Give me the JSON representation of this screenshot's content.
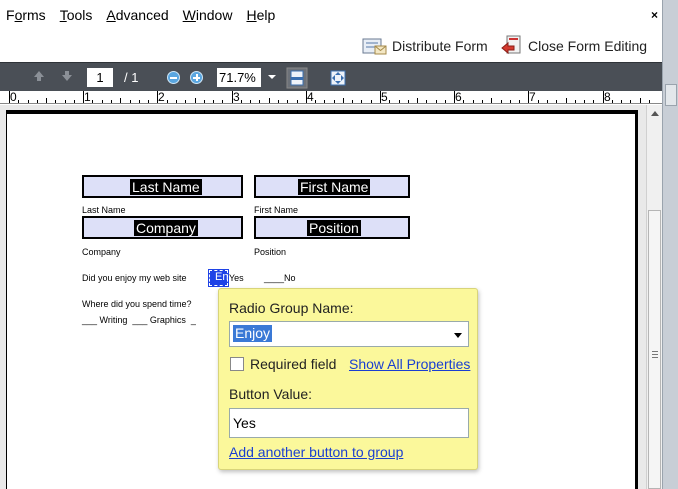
{
  "menu": {
    "items": [
      {
        "pre": "F",
        "u": "o",
        "post": "rms"
      },
      {
        "pre": "",
        "u": "T",
        "post": "ools"
      },
      {
        "pre": "",
        "u": "A",
        "post": "dvanced"
      },
      {
        "pre": "",
        "u": "W",
        "post": "indow"
      },
      {
        "pre": "",
        "u": "H",
        "post": "elp"
      }
    ],
    "close": "×"
  },
  "formbar": {
    "distribute": "Distribute Form",
    "close_editing": "Close Form Editing"
  },
  "navbar": {
    "page_current": "1",
    "page_total": "/ 1",
    "zoom": "71.7%"
  },
  "ruler": {
    "labels": [
      "0",
      "1",
      "2",
      "3",
      "4",
      "5",
      "6",
      "7",
      "8"
    ]
  },
  "form": {
    "last_name_field": "Last Name",
    "first_name_field": "First Name",
    "last_name_caption": "Last Name",
    "first_name_caption": "First Name",
    "company_field": "Company",
    "position_field": "Position",
    "company_caption": "Company",
    "position_caption": "Position",
    "question1": "Did you enjoy my web site",
    "radio_label": "En",
    "yes_text": "Yes",
    "no_text": "____No",
    "question2": "Where did you spend time?",
    "options": "___ Writing  ___ Graphics  _"
  },
  "popup": {
    "group_label": "Radio Group Name:",
    "group_value": "Enjoy",
    "required_label": "Required field",
    "show_all": "Show All Properties",
    "button_value_label": "Button Value:",
    "button_value": "Yes",
    "add_button": "Add another button to group"
  },
  "colors": {
    "field_fill": "#dde0f8",
    "popup_bg": "#fbf89b",
    "link": "#1a3fd1",
    "selection": "#3a79d6",
    "radio_fill": "#1f43e6"
  }
}
